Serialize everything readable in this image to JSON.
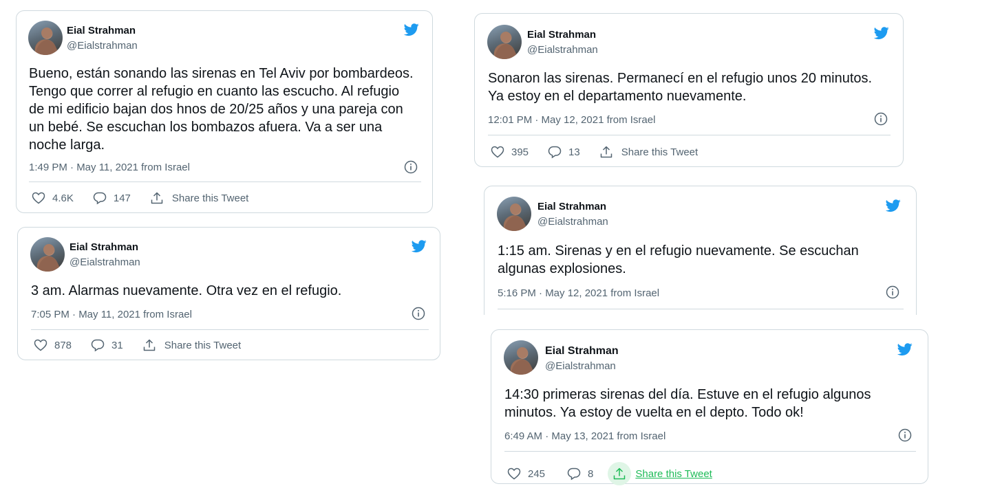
{
  "colors": {
    "brand": "#1d9bf0",
    "text": "#0f1419",
    "muted": "#536471",
    "share_active": "#1dbb57"
  },
  "icons": {
    "bird": "twitter-bird-icon",
    "like": "heart-icon",
    "reply": "reply-bubble-icon",
    "share": "share-icon",
    "info": "info-icon"
  },
  "tweets": [
    {
      "author": "Eial Strahman",
      "handle": "@Eialstrahman",
      "text": "Bueno, están sonando las sirenas en Tel Aviv por bombardeos. Tengo que correr al refugio en cuanto las escucho. Al refugio de mi edificio bajan dos hnos de 20/25 años y una pareja con un bebé. Se escuchan los bombazos afuera. Va a ser una noche larga.",
      "timestamp": "1:49 PM · May 11, 2021 from Israel",
      "likes": "4.6K",
      "replies": "147",
      "share_label": "Share this Tweet"
    },
    {
      "author": "Eial Strahman",
      "handle": "@Eialstrahman",
      "text": "3 am. Alarmas nuevamente. Otra vez en el refugio.",
      "timestamp": "7:05 PM · May 11, 2021 from Israel",
      "likes": "878",
      "replies": "31",
      "share_label": "Share this Tweet"
    },
    {
      "author": "Eial Strahman",
      "handle": "@Eialstrahman",
      "text": "Sonaron las sirenas. Permanecí en el refugio unos 20 minutos. Ya estoy en el departamento nuevamente.",
      "timestamp": "12:01 PM · May 12, 2021 from Israel",
      "likes": "395",
      "replies": "13",
      "share_label": "Share this Tweet"
    },
    {
      "author": "Eial Strahman",
      "handle": "@Eialstrahman",
      "text": "1:15 am. Sirenas y en el refugio nuevamente. Se escuchan algunas explosiones.",
      "timestamp": "5:16 PM · May 12, 2021 from Israel"
    },
    {
      "author": "Eial Strahman",
      "handle": "@Eialstrahman",
      "text": "14:30 primeras sirenas del día. Estuve en el refugio algunos minutos. Ya estoy de vuelta en el depto. Todo ok!",
      "timestamp": "6:49 AM · May 13, 2021 from Israel",
      "likes": "245",
      "replies": "8",
      "share_label": "Share this Tweet"
    }
  ]
}
